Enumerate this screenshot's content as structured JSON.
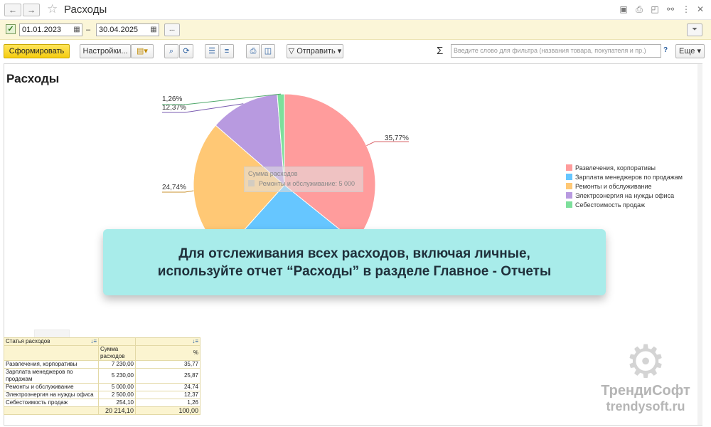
{
  "window": {
    "title": "Расходы",
    "back_icon": "←",
    "forward_icon": "→",
    "star_icon": "☆"
  },
  "filter": {
    "checked_mark": "✓",
    "date_from": "01.01.2023",
    "date_to": "30.04.2025",
    "dash": "–",
    "more": "...",
    "calendar_icon": "▦",
    "filter_icon": "⏷"
  },
  "toolbar": {
    "generate": "Сформировать",
    "settings": "Настройки...",
    "send": "Отправить",
    "search_placeholder": "Введите слово для фильтра (названия товара, покупателя и пр.)",
    "help": "?",
    "more": "Еще",
    "sigma": "Σ"
  },
  "report": {
    "title": "Расходы"
  },
  "chart_data": {
    "type": "pie",
    "title": "Расходы",
    "slices": [
      {
        "label": "Развлечения, корпоративы",
        "value": 7230.0,
        "percent": 35.77,
        "percent_label": "35,77%",
        "color": "#ff9c9c"
      },
      {
        "label": "Зарплата менеджеров по продажам",
        "value": 5230.0,
        "percent": 25.87,
        "percent_label": "",
        "color": "#66c6ff"
      },
      {
        "label": "Ремонты и обслуживание",
        "value": 5000.0,
        "percent": 24.74,
        "percent_label": "24,74%",
        "color": "#ffc875"
      },
      {
        "label": "Электроэнергия на нужды офиса",
        "value": 2500.0,
        "percent": 12.37,
        "percent_label": "12,37%",
        "color": "#b89ae0"
      },
      {
        "label": "Себестоимость продаж",
        "value": 254.1,
        "percent": 1.26,
        "percent_label": "1,26%",
        "color": "#7ddf9b"
      }
    ],
    "legend_position": "right",
    "tooltip": {
      "title": "Сумма расходов",
      "text": "Ремонты и обслуживание: 5 000"
    }
  },
  "banner": {
    "line1": "Для отслеживания всех расходов, включая личные,",
    "line2": "используйте отчет “Расходы” в разделе Главное - Отчеты"
  },
  "table": {
    "col1": "Статья расходов",
    "col2": "Сумма расходов",
    "col3": "%",
    "rows": [
      {
        "name": "Развлечения, корпоративы",
        "sum": "7 230,00",
        "pct": "35,77"
      },
      {
        "name": "Зарплата менеджеров по продажам",
        "sum": "5 230,00",
        "pct": "25,87"
      },
      {
        "name": "Ремонты и обслуживание",
        "sum": "5 000,00",
        "pct": "24,74"
      },
      {
        "name": "Электроэнергия на нужды офиса",
        "sum": "2 500,00",
        "pct": "12,37"
      },
      {
        "name": "Себестоимость продаж",
        "sum": "254,10",
        "pct": "1,26"
      }
    ],
    "total_sum": "20 214,10",
    "total_pct": "100,00"
  },
  "watermark": {
    "name": "ТрендиСофт",
    "url": "trendysoft.ru"
  }
}
